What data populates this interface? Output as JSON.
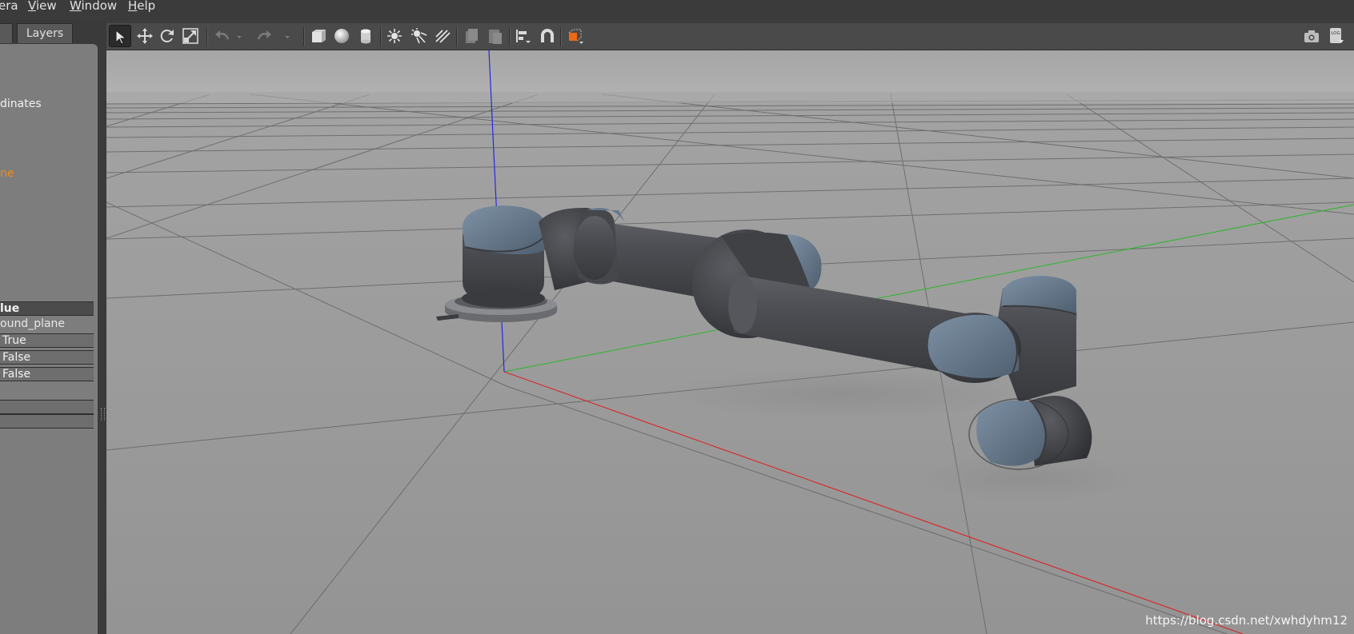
{
  "menubar": {
    "items": [
      {
        "label": "era",
        "mnemonic": ""
      },
      {
        "label": "iew",
        "mnemonic": "V"
      },
      {
        "label": "indow",
        "mnemonic": "W"
      },
      {
        "label": "elp",
        "mnemonic": "H"
      }
    ]
  },
  "left_panel": {
    "tabs": {
      "world": "",
      "layers": "Layers"
    },
    "tree": {
      "coordinates_item": "dinates",
      "selected_item": "ne"
    },
    "properties": {
      "header": "lue",
      "rows": [
        {
          "value": "ound_plane",
          "style": "plain"
        },
        {
          "value": "True",
          "style": "boxed"
        },
        {
          "value": "False",
          "style": "boxed"
        },
        {
          "value": "False",
          "style": "boxed"
        },
        {
          "value": "",
          "style": "boxed"
        },
        {
          "value": "",
          "style": "boxed"
        }
      ]
    }
  },
  "toolbar": {
    "tools": [
      {
        "name": "select-mode",
        "icon": "arrow-pointer-icon",
        "active": true
      },
      {
        "name": "translate-mode",
        "icon": "move-arrows-icon"
      },
      {
        "name": "rotate-mode",
        "icon": "rotate-icon"
      },
      {
        "name": "scale-mode",
        "icon": "scale-icon"
      },
      {
        "name": "undo",
        "icon": "undo-icon",
        "disabled": true
      },
      {
        "name": "redo",
        "icon": "redo-icon",
        "disabled": true
      },
      {
        "name": "box-shape",
        "icon": "box-icon"
      },
      {
        "name": "sphere-shape",
        "icon": "sphere-icon"
      },
      {
        "name": "cylinder-shape",
        "icon": "cylinder-icon"
      },
      {
        "name": "point-light",
        "icon": "point-light-icon"
      },
      {
        "name": "spot-light",
        "icon": "spot-light-icon"
      },
      {
        "name": "directional-light",
        "icon": "directional-light-icon"
      },
      {
        "name": "copy",
        "icon": "copy-icon",
        "disabled": true
      },
      {
        "name": "paste",
        "icon": "paste-icon",
        "disabled": true
      },
      {
        "name": "align",
        "icon": "align-icon"
      },
      {
        "name": "snap",
        "icon": "magnet-icon"
      },
      {
        "name": "view-angle",
        "icon": "view-angle-cube-icon"
      },
      {
        "name": "screenshot",
        "icon": "camera-icon"
      },
      {
        "name": "log",
        "icon": "log-icon"
      }
    ],
    "log_label": "LOG"
  },
  "viewport": {
    "watermark": "https://blog.csdn.net/xwhdyhm12",
    "colors": {
      "sky": "#a9a9a9",
      "ground": "#9a9a9a",
      "grid_line": "#5e5e5e",
      "axis_x": "#e21b1b",
      "axis_y": "#28b828",
      "axis_z": "#2626e6",
      "robot_body": "#4b4d52",
      "robot_cap": "#65788c"
    }
  }
}
